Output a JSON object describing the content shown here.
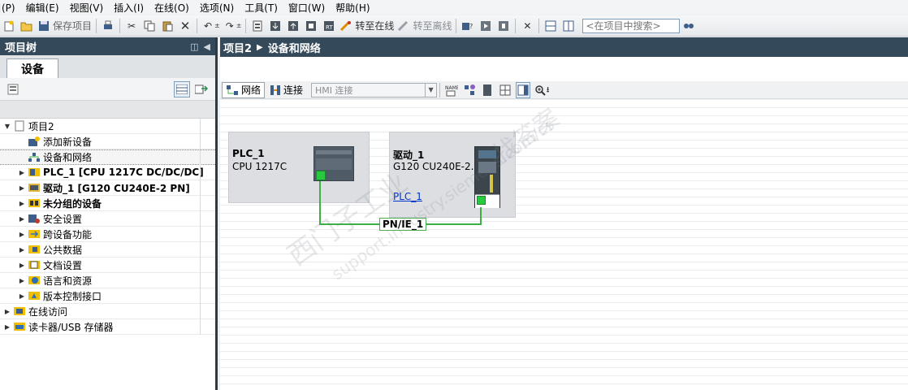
{
  "menu": [
    "目(P)",
    "编辑(E)",
    "视图(V)",
    "插入(I)",
    "在线(O)",
    "选项(N)",
    "工具(T)",
    "窗口(W)",
    "帮助(H)"
  ],
  "toolbar": {
    "save_project": "保存项目",
    "go_online": "转至在线",
    "go_offline": "转至离线",
    "search_placeholder": "<在项目中搜索>"
  },
  "left_panel": {
    "title": "项目树",
    "tab": "设备",
    "tree": [
      {
        "label": "项目2",
        "level": 0,
        "arrow": "▼",
        "icon": "project-icon",
        "bold": false
      },
      {
        "label": "添加新设备",
        "level": 1,
        "arrow": "",
        "icon": "add-device-icon",
        "bold": false
      },
      {
        "label": "设备和网络",
        "level": 1,
        "arrow": "",
        "icon": "network-icon",
        "bold": false,
        "selected": true
      },
      {
        "label": "PLC_1 [CPU 1217C DC/DC/DC]",
        "level": 1,
        "arrow": "▶",
        "icon": "plc-icon",
        "bold": true
      },
      {
        "label": "驱动_1 [G120 CU240E-2 PN]",
        "level": 1,
        "arrow": "▶",
        "icon": "drive-icon",
        "bold": true
      },
      {
        "label": "未分组的设备",
        "level": 1,
        "arrow": "▶",
        "icon": "ungrouped-icon",
        "bold": true
      },
      {
        "label": "安全设置",
        "level": 1,
        "arrow": "▶",
        "icon": "security-icon",
        "bold": false
      },
      {
        "label": "跨设备功能",
        "level": 1,
        "arrow": "▶",
        "icon": "cross-device-icon",
        "bold": false
      },
      {
        "label": "公共数据",
        "level": 1,
        "arrow": "▶",
        "icon": "common-data-icon",
        "bold": false
      },
      {
        "label": "文档设置",
        "level": 1,
        "arrow": "▶",
        "icon": "doc-settings-icon",
        "bold": false
      },
      {
        "label": "语言和资源",
        "level": 1,
        "arrow": "▶",
        "icon": "language-icon",
        "bold": false
      },
      {
        "label": "版本控制接口",
        "level": 1,
        "arrow": "▶",
        "icon": "version-control-icon",
        "bold": false
      },
      {
        "label": "在线访问",
        "level": 0,
        "arrow": "▶",
        "icon": "online-access-icon",
        "bold": false
      },
      {
        "label": "读卡器/USB 存储器",
        "level": 0,
        "arrow": "▶",
        "icon": "card-reader-icon",
        "bold": false
      }
    ]
  },
  "right_panel": {
    "breadcrumb": [
      "项目2",
      "设备和网络"
    ],
    "tab_network": "网络",
    "tab_connection": "连接",
    "hmi_select": "HMI 连接",
    "devices": {
      "plc": {
        "name": "PLC_1",
        "type": "CPU 1217C"
      },
      "drive": {
        "name": "驱动_1",
        "type": "G120 CU240E-2...",
        "link": "PLC_1"
      }
    },
    "network_label": "PN/IE_1"
  },
  "watermark": [
    "西门子工业",
    "support.industry.siemens.com/cs",
    "找答案"
  ],
  "colors": {
    "title_bar": "#34495a",
    "network_green": "#3cb043",
    "link_blue": "#0033cc"
  }
}
